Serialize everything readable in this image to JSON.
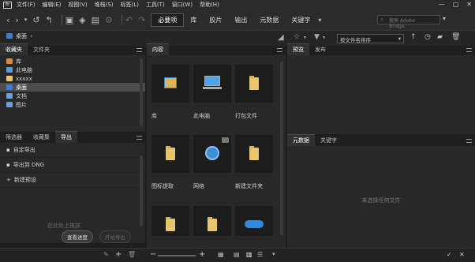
{
  "menubar": {
    "logo": "Br",
    "items": [
      "文件(F)",
      "编辑(E)",
      "视图(V)",
      "堆栈(S)",
      "标签(L)",
      "工具(T)",
      "窗口(W)",
      "帮助(H)"
    ],
    "controls": [
      "—",
      "▢",
      "✕"
    ]
  },
  "toolbar": {
    "workspaces": [
      "必要项",
      "库",
      "胶片",
      "输出",
      "元数据",
      "关键字"
    ],
    "search_placeholder": "搜索 Adobe Bridge"
  },
  "path": {
    "current": "桌面"
  },
  "sort": {
    "label": "按文件名排序"
  },
  "left_panel": {
    "tabs": [
      "收藏夹",
      "文件夹"
    ],
    "favorites": [
      {
        "label": "库",
        "color": "#d98a3c"
      },
      {
        "label": "此电脑",
        "color": "#5a9bd8"
      },
      {
        "label": "xxxxx",
        "color": "#e8c76a"
      },
      {
        "label": "桌面",
        "color": "#3b7fd4"
      },
      {
        "label": "文档",
        "color": "#6aa0d8"
      },
      {
        "label": "图片",
        "color": "#6aa0d8"
      }
    ],
    "export_tabs": [
      "筛选器",
      "收藏集",
      "导出"
    ],
    "export_items": [
      "自定导出",
      "导出到 DNG",
      "新建预设"
    ],
    "drop_hint": "在此处上拖放",
    "progress_button": "查看进度",
    "start_button": "开始导出"
  },
  "content": {
    "tab": "内容",
    "items": [
      {
        "label": "库",
        "icon": "library-folder-icon"
      },
      {
        "label": "此电脑",
        "icon": "computer-icon"
      },
      {
        "label": "打包文件",
        "icon": "folder-icon"
      },
      {
        "label": "图标提取",
        "icon": "folder-icon"
      },
      {
        "label": "网络",
        "icon": "network-icon"
      },
      {
        "label": "新建文件夹",
        "icon": "folder-icon"
      },
      {
        "label": "",
        "icon": "folder-icon"
      },
      {
        "label": "",
        "icon": "folder-icon"
      },
      {
        "label": "",
        "icon": "onedrive-icon"
      }
    ]
  },
  "right_panel": {
    "top_tabs": [
      "预览",
      "发布"
    ],
    "bottom_tabs": [
      "元数据",
      "关键字"
    ],
    "empty_text": "未选择任何文件"
  }
}
